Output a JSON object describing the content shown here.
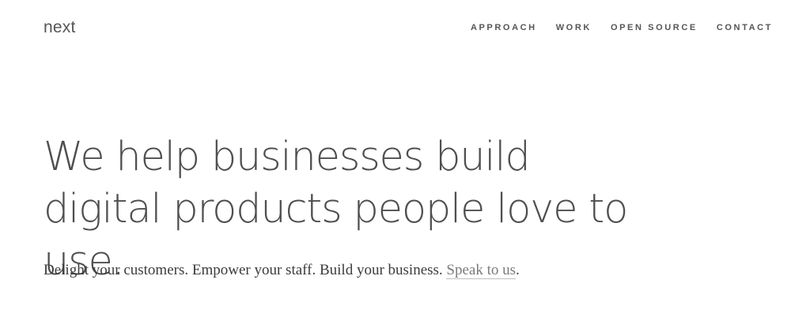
{
  "header": {
    "logo_text": "next",
    "nav": [
      {
        "label": "APPROACH"
      },
      {
        "label": "WORK"
      },
      {
        "label": "OPEN SOURCE"
      },
      {
        "label": "CONTACT"
      }
    ]
  },
  "hero": {
    "headline": "We help businesses build digital products people love to use.",
    "tagline_text": "Delight your customers. Empower your staff. Build your business. ",
    "tagline_link": "Speak to us",
    "tagline_end": "."
  },
  "colors": {
    "background": "#ffffff",
    "text": "#4a4a4a",
    "link": "#7a7a7a"
  }
}
